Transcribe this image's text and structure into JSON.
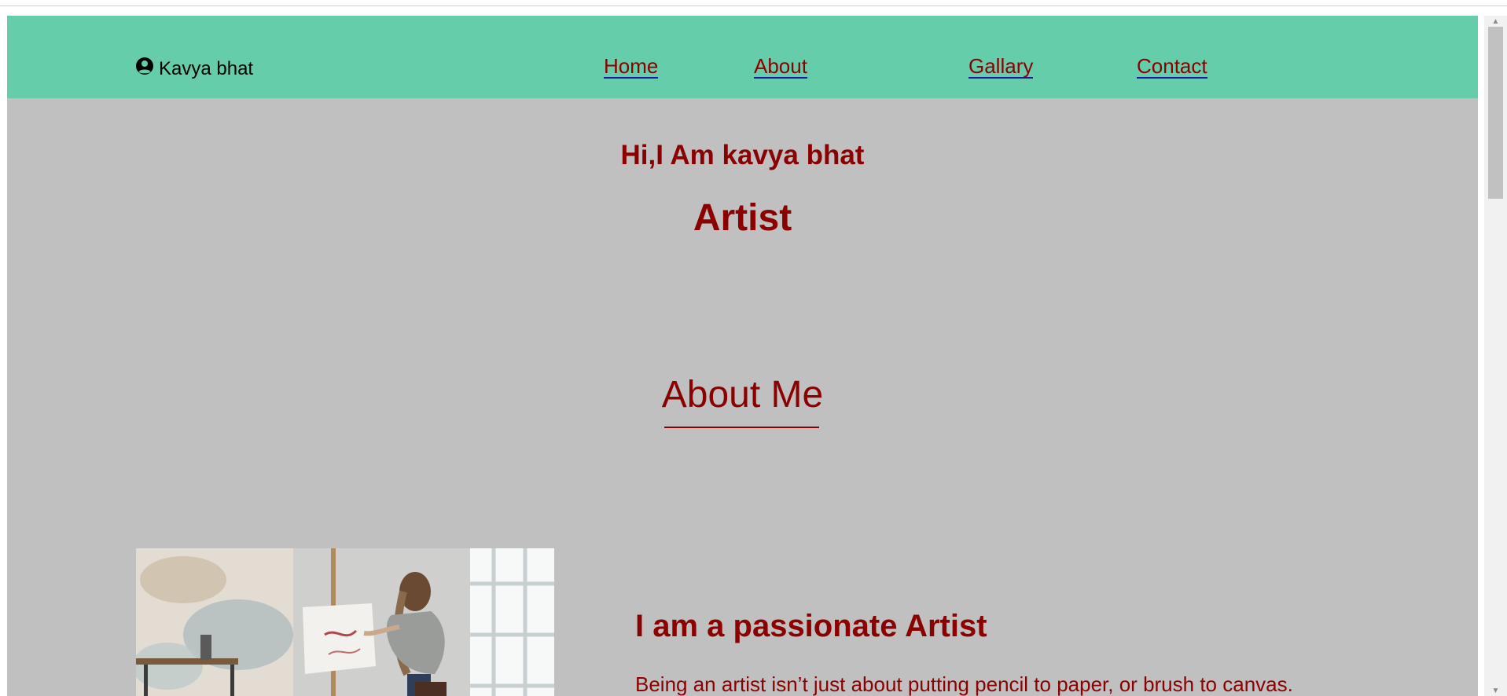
{
  "nav": {
    "brand_name": "Kavya bhat",
    "brand_icon": "user-circle-icon",
    "links": [
      {
        "label": "Home"
      },
      {
        "label": "About"
      },
      {
        "label": "Gallary"
      },
      {
        "label": "Contact"
      }
    ]
  },
  "hero": {
    "greeting": "Hi,I Am kavya bhat",
    "role": "Artist"
  },
  "about": {
    "title": "About Me",
    "heading": "I am a passionate Artist",
    "text": "Being an artist isn’t just about putting pencil to paper, or brush to canvas."
  },
  "colors": {
    "navbar": "#66cdaa",
    "page_bg": "#c0c0c0",
    "accent_text": "#8b0000"
  }
}
